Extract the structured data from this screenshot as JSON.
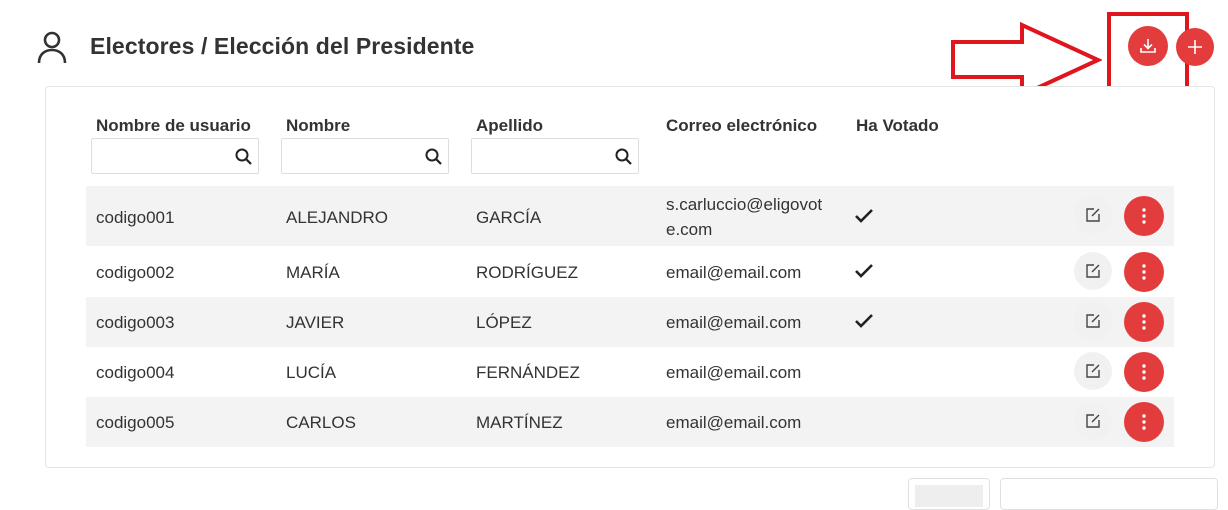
{
  "header": {
    "title": "Electores / Elección del Presidente",
    "icon": "user-icon",
    "download_icon": "download-icon",
    "add_icon": "plus-icon",
    "accent_color": "#e23c3c",
    "annotation_color": "#e0161e"
  },
  "table": {
    "columns": [
      "Nombre de usuario",
      "Nombre",
      "Apellido",
      "Correo electrónico",
      "Ha Votado"
    ],
    "rows": [
      {
        "usuario": "codigo001",
        "nombre": "ALEJANDRO",
        "apellido": "GARCÍA",
        "correo_line1": "s.carluccio@eligovot",
        "correo_line2": "e.com",
        "ha_votado": true
      },
      {
        "usuario": "codigo002",
        "nombre": "MARÍA",
        "apellido": "RODRÍGUEZ",
        "correo": "email@email.com",
        "ha_votado": true
      },
      {
        "usuario": "codigo003",
        "nombre": "JAVIER",
        "apellido": "LÓPEZ",
        "correo": "email@email.com",
        "ha_votado": true
      },
      {
        "usuario": "codigo004",
        "nombre": "LUCÍA",
        "apellido": "FERNÁNDEZ",
        "correo": "email@email.com",
        "ha_votado": false
      },
      {
        "usuario": "codigo005",
        "nombre": "CARLOS",
        "apellido": "MARTÍNEZ",
        "correo": "email@email.com",
        "ha_votado": false
      }
    ]
  }
}
